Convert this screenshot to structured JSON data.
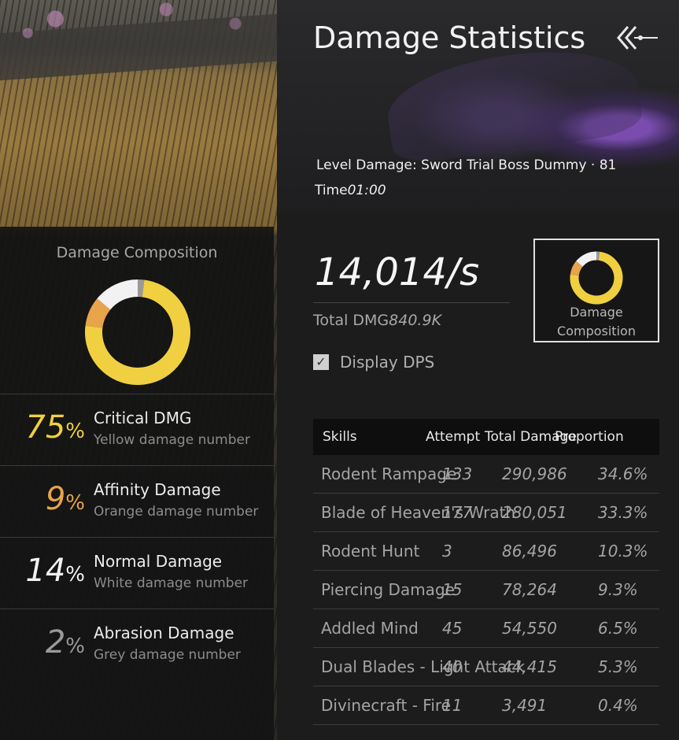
{
  "header": {
    "title": "Damage Statistics",
    "level_prefix": "Level Damage: ",
    "level_name": "Sword Trial Boss Dummy · 81",
    "time_label": "Time",
    "time_value": "01:00"
  },
  "summary": {
    "dps": "14,014/s",
    "total_label": "Total DMG",
    "total_value": "840.9K",
    "display_dps_label": "Display DPS",
    "display_dps_checked": true,
    "composition_button_label": "Damage Composition"
  },
  "composition": {
    "title": "Damage Composition",
    "items": [
      {
        "percent": 75,
        "pct_text": "75",
        "name": "Critical DMG",
        "desc": "Yellow damage number",
        "color": "#f0d040"
      },
      {
        "percent": 9,
        "pct_text": "9",
        "name": "Affinity Damage",
        "desc": "Orange damage number",
        "color": "#e8a44a"
      },
      {
        "percent": 14,
        "pct_text": "14",
        "name": "Normal Damage",
        "desc": "White damage number",
        "color": "#f2f2f2"
      },
      {
        "percent": 2,
        "pct_text": "2",
        "name": "Abrasion Damage",
        "desc": "Grey damage number",
        "color": "#9a9a9a"
      }
    ]
  },
  "skills_table": {
    "headers": [
      "Skills",
      "Attempt",
      "Total Damage",
      "Proportion"
    ],
    "rows": [
      {
        "skill": "Rodent Rampage",
        "attempt": "133",
        "total": "290,986",
        "proportion": "34.6%"
      },
      {
        "skill": "Blade of Heaven's Wrath",
        "attempt": "177",
        "total": "280,051",
        "proportion": "33.3%"
      },
      {
        "skill": "Rodent Hunt",
        "attempt": "3",
        "total": "86,496",
        "proportion": "10.3%"
      },
      {
        "skill": "Piercing Damage",
        "attempt": "15",
        "total": "78,264",
        "proportion": "9.3%"
      },
      {
        "skill": "Addled Mind",
        "attempt": "45",
        "total": "54,550",
        "proportion": "6.5%"
      },
      {
        "skill": "Dual Blades - Light Attack",
        "attempt": "40",
        "total": "44,415",
        "proportion": "5.3%"
      },
      {
        "skill": "Divinecraft - Fire",
        "attempt": "11",
        "total": "3,491",
        "proportion": "0.4%"
      }
    ]
  },
  "icons": {
    "back": "back-arrow-icon",
    "checkbox": "check-icon"
  }
}
